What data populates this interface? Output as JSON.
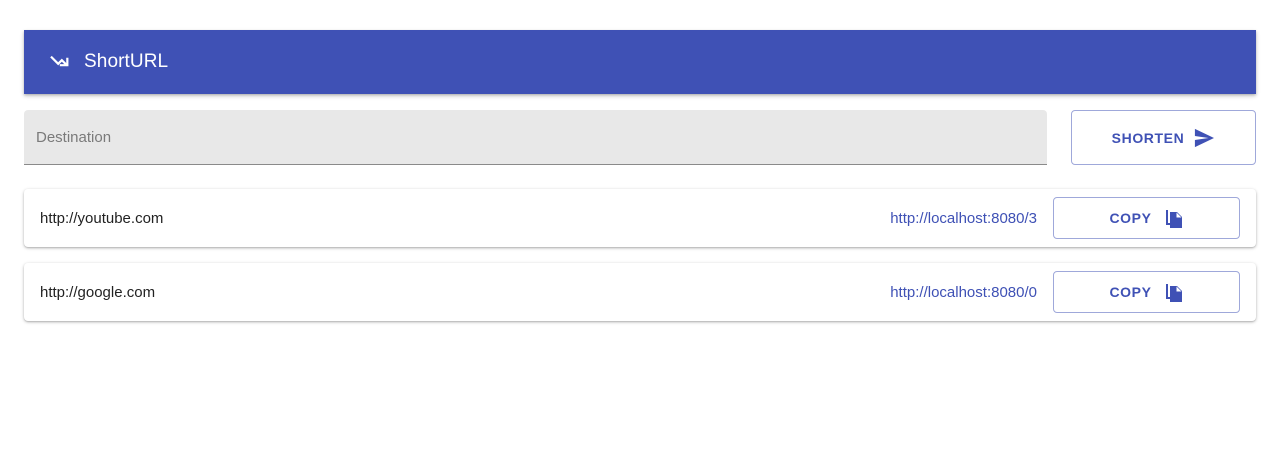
{
  "app": {
    "title": "ShortURL",
    "logo_icon": "trending-down-icon",
    "accent_color": "#3f51b5"
  },
  "form": {
    "destination_placeholder": "Destination",
    "destination_value": "",
    "shorten_label": "SHORTEN",
    "shorten_icon": "send-icon"
  },
  "links": [
    {
      "original": "http://youtube.com",
      "short": "http://localhost:8080/3",
      "copy_label": "COPY",
      "copy_icon": "file-copy-icon"
    },
    {
      "original": "http://google.com",
      "short": "http://localhost:8080/0",
      "copy_label": "COPY",
      "copy_icon": "file-copy-icon"
    }
  ]
}
